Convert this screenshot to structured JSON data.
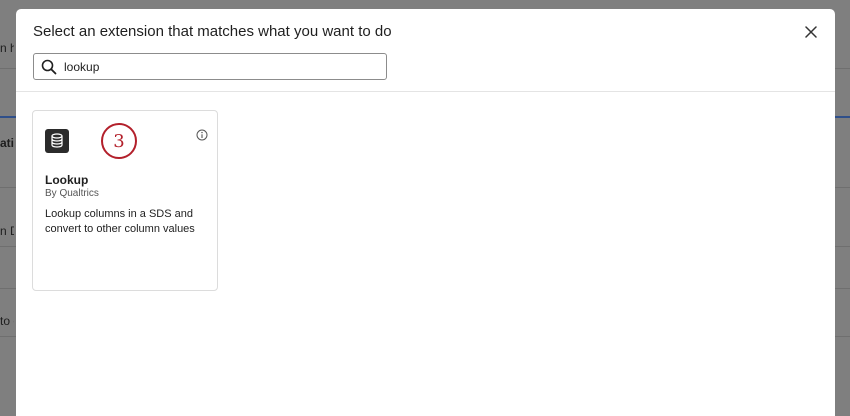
{
  "background": {
    "fragments": [
      "n his",
      "atis",
      "n Da",
      "to c"
    ]
  },
  "modal": {
    "title": "Select an extension that matches what you want to do",
    "close_icon": "close-icon",
    "search": {
      "icon": "search-icon",
      "value": "lookup"
    },
    "step_badge": "3",
    "results": [
      {
        "title": "Lookup",
        "vendor": "By Qualtrics",
        "description": "Lookup columns in a SDS and convert to other column values",
        "icon": "database-icon",
        "info_icon": "info-icon"
      }
    ]
  },
  "colors": {
    "overlay": "#7f7f7f",
    "step_badge": "#b3202b",
    "card_icon_bg": "#2b2b2b"
  }
}
